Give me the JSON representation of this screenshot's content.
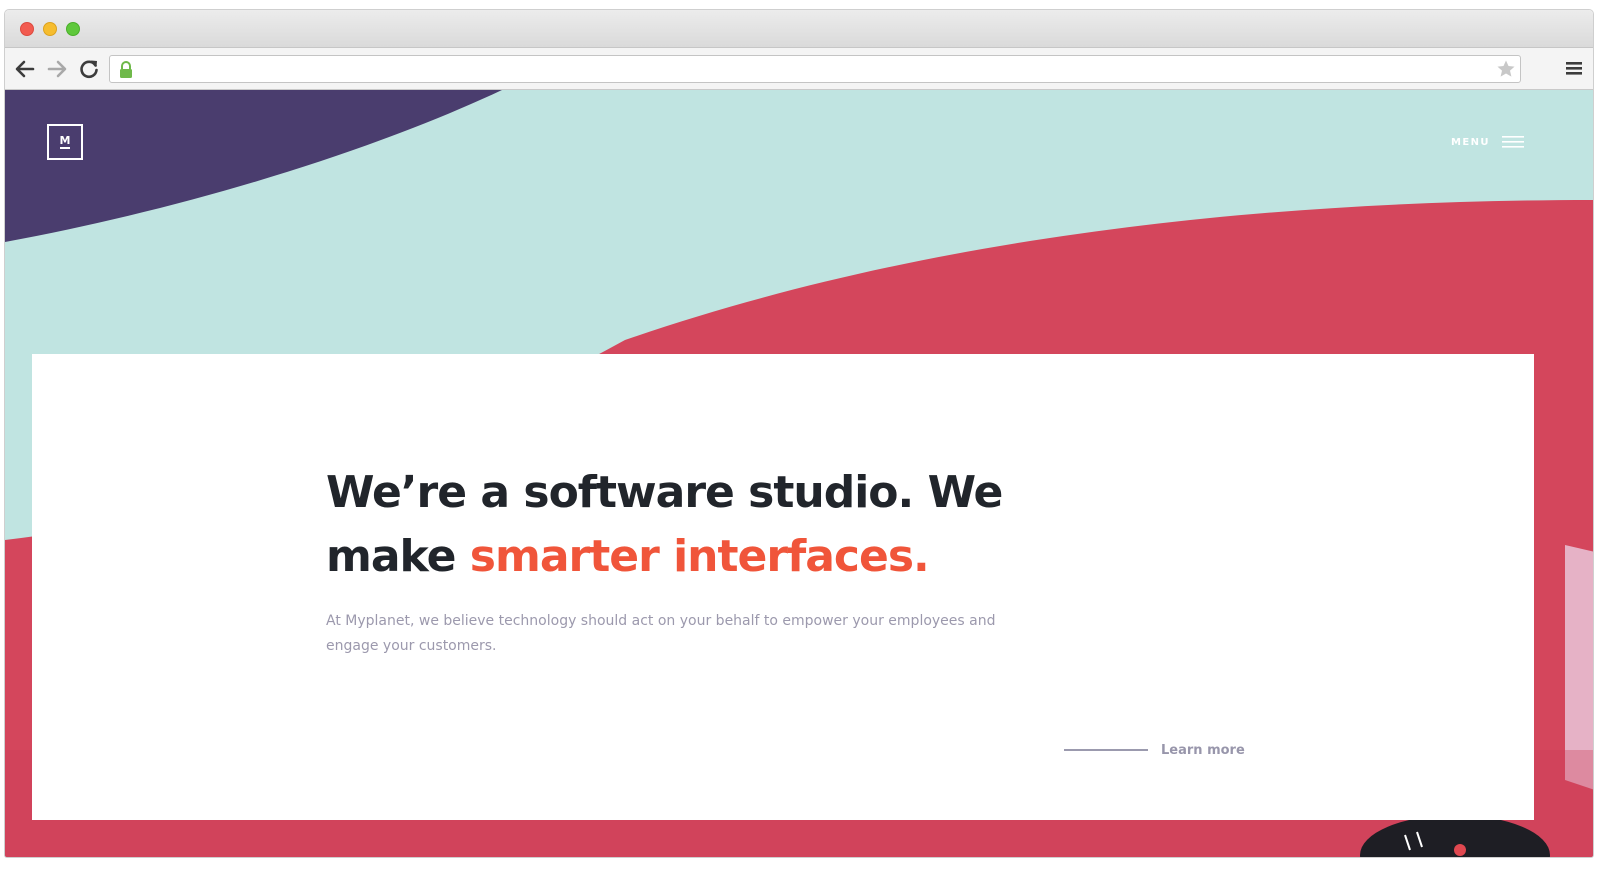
{
  "browser": {
    "url": "",
    "icons": {
      "back": "arrow-left-icon",
      "forward": "arrow-right-icon",
      "reload": "reload-icon",
      "lock": "lock-icon",
      "bookmark": "star-icon",
      "menu": "hamburger-menu-icon"
    },
    "lock_color": "#6fb94a"
  },
  "site": {
    "logo_letter": "M",
    "menu_label": "MENU",
    "colors": {
      "purple": "#4a3d6e",
      "mint": "#c0e4e1",
      "red": "#d4465c",
      "pink": "#e6b2c6",
      "accent_orange": "#f0553a",
      "headline_dark": "#21252b",
      "body_gray": "#9c99ad"
    }
  },
  "hero": {
    "headline_part1": "We’re a software studio. We make ",
    "headline_accent": "smarter interfaces.",
    "subcopy": "At Myplanet, we believe technology should act on your behalf to empower your employees and engage your customers.",
    "cta_label": "Learn more"
  }
}
